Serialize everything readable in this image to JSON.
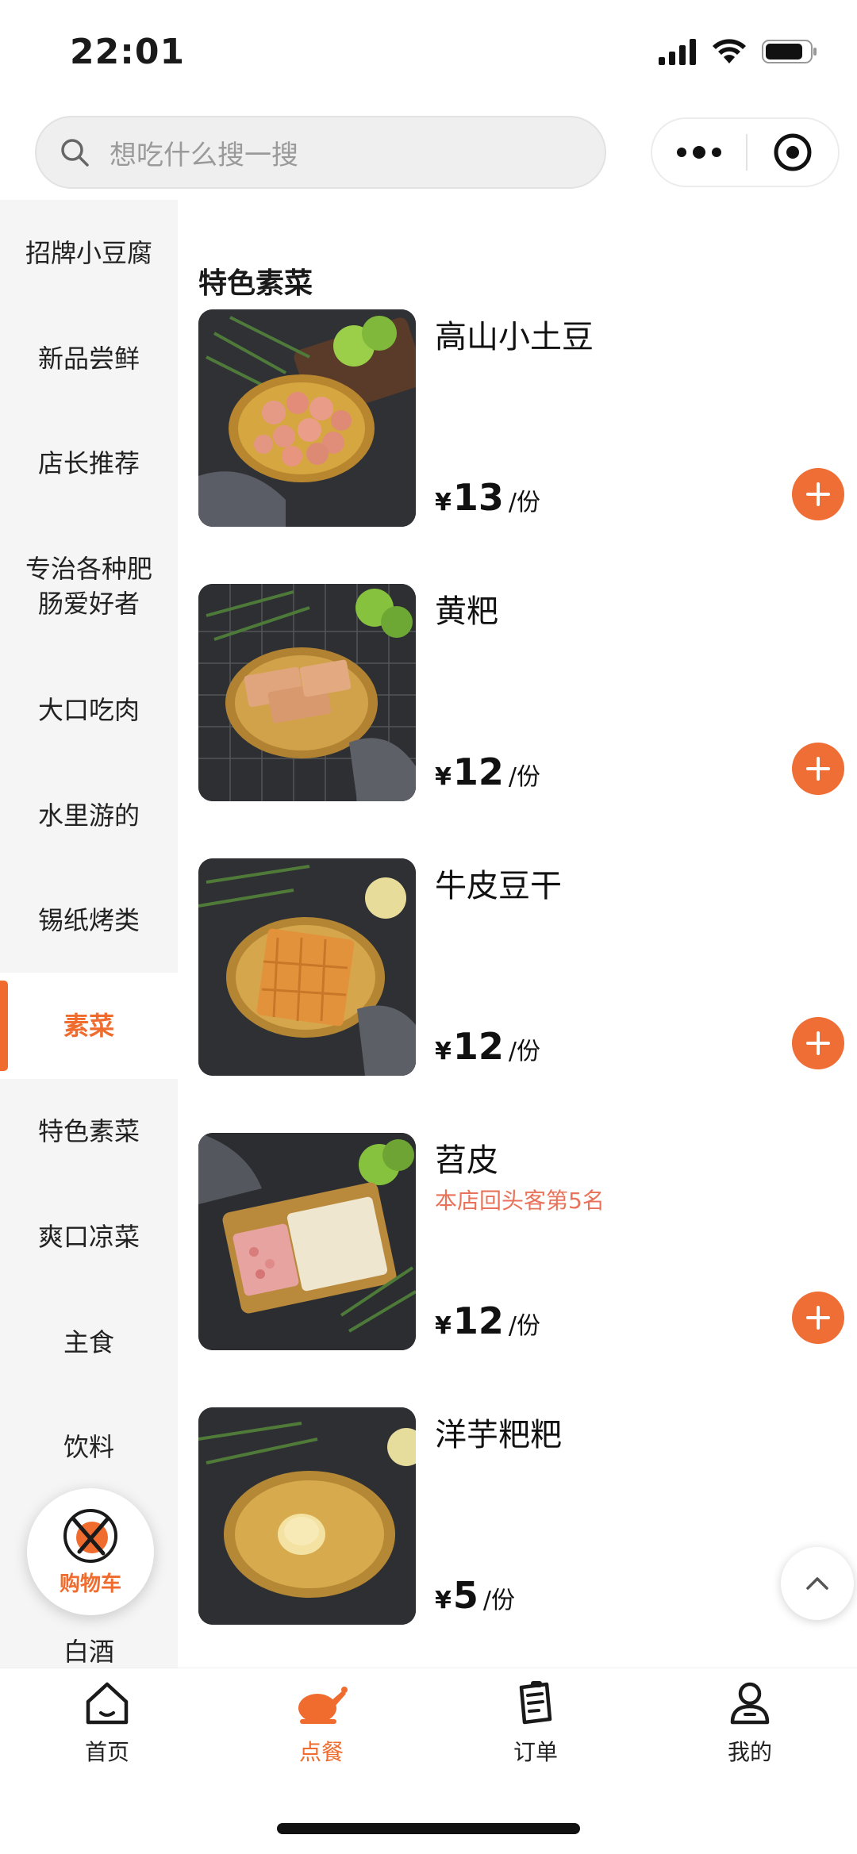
{
  "status_bar": {
    "time": "22:01"
  },
  "search": {
    "placeholder": "想吃什么搜一搜"
  },
  "sidebar": {
    "items": [
      {
        "label": "招牌小豆腐",
        "active": false
      },
      {
        "label": "新品尝鲜",
        "active": false
      },
      {
        "label": "店长推荐",
        "active": false
      },
      {
        "label": "专治各种肥肠爱好者",
        "active": false
      },
      {
        "label": "大口吃肉",
        "active": false
      },
      {
        "label": "水里游的",
        "active": false
      },
      {
        "label": "锡纸烤类",
        "active": false
      },
      {
        "label": "素菜",
        "active": true
      },
      {
        "label": "特色素菜",
        "active": false
      },
      {
        "label": "爽口凉菜",
        "active": false
      },
      {
        "label": "主食",
        "active": false
      },
      {
        "label": "饮料",
        "active": false
      },
      {
        "label": "白酒",
        "active": false
      }
    ]
  },
  "section": {
    "title": "特色素菜"
  },
  "items": [
    {
      "name": "高山小土豆",
      "tag": "",
      "currency": "¥",
      "price": "13",
      "unit": "/份",
      "food": "potatoes"
    },
    {
      "name": "黄粑",
      "tag": "",
      "currency": "¥",
      "price": "12",
      "unit": "/份",
      "food": "huangba"
    },
    {
      "name": "牛皮豆干",
      "tag": "",
      "currency": "¥",
      "price": "12",
      "unit": "/份",
      "food": "tofu-skin"
    },
    {
      "name": "苕皮",
      "tag": "本店回头客第5名",
      "currency": "¥",
      "price": "12",
      "unit": "/份",
      "food": "sweet-potato-sheet"
    },
    {
      "name": "洋芋粑粑",
      "tag": "",
      "currency": "¥",
      "price": "5",
      "unit": "/份",
      "food": "potato-cake"
    }
  ],
  "cart": {
    "label": "购物车"
  },
  "tabbar": {
    "items": [
      {
        "label": "首页",
        "icon": "home-icon",
        "active": false
      },
      {
        "label": "点餐",
        "icon": "chicken-icon",
        "active": true
      },
      {
        "label": "订单",
        "icon": "order-icon",
        "active": false
      },
      {
        "label": "我的",
        "icon": "user-icon",
        "active": false
      }
    ]
  },
  "colors": {
    "accent": "#EF6C2E",
    "tag": "#E8735A",
    "sidebar_bg": "#F5F5F5"
  }
}
